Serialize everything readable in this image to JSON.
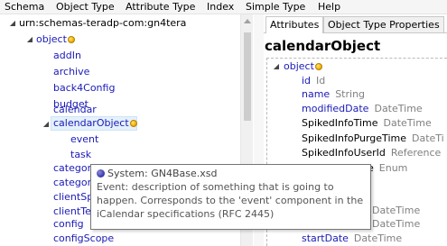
{
  "menu": [
    "Schema",
    "Object Type",
    "Attribute Type",
    "Index",
    "Simple Type",
    "Help"
  ],
  "tree": {
    "root": "urn:schemas-teradp-com:gn4tera",
    "object": "object",
    "children": [
      "addIn",
      "archive",
      "back4Config",
      "budget",
      "calendar",
      "calendarObject"
    ],
    "calendarObject_children": [
      "event",
      "task"
    ],
    "after": [
      "categor",
      "categor",
      "clientSp",
      "clientTe",
      "config",
      "configScope"
    ]
  },
  "tabs": {
    "attributes": "Attributes",
    "object_type_properties": "Object Type Properties"
  },
  "detail": {
    "heading": "calendarObject",
    "object_label": "object",
    "properties": [
      {
        "name": "id",
        "type": "Id",
        "black": false
      },
      {
        "name": "name",
        "type": "String",
        "black": false
      },
      {
        "name": "modifiedDate",
        "type": "DateTime",
        "black": false
      },
      {
        "name": "SpikedInfoTime",
        "type": "DateTime",
        "black": true
      },
      {
        "name": "SpikedInfoPurgeTime",
        "type": "DateTi",
        "black": true
      },
      {
        "name": "SpikedInfoUserId",
        "type": "Reference",
        "black": true
      },
      {
        "name": "e",
        "type": "Enum",
        "black": true
      }
    ],
    "partial_rows": [
      "DateTime",
      "DateTime"
    ],
    "last": {
      "name": "startDate",
      "type": "DateTime"
    }
  },
  "tooltip": {
    "title": "System:  GN4Base.xsd",
    "description": "Event: description of something that is going to happen. Corresponds to the 'event' component in the iCalendar specifications (RFC 2445)"
  },
  "colors": {
    "link": "#1a1ab8",
    "type_gray": "#808080",
    "selection": "#e5f1fb",
    "dot": "#f0b400"
  }
}
